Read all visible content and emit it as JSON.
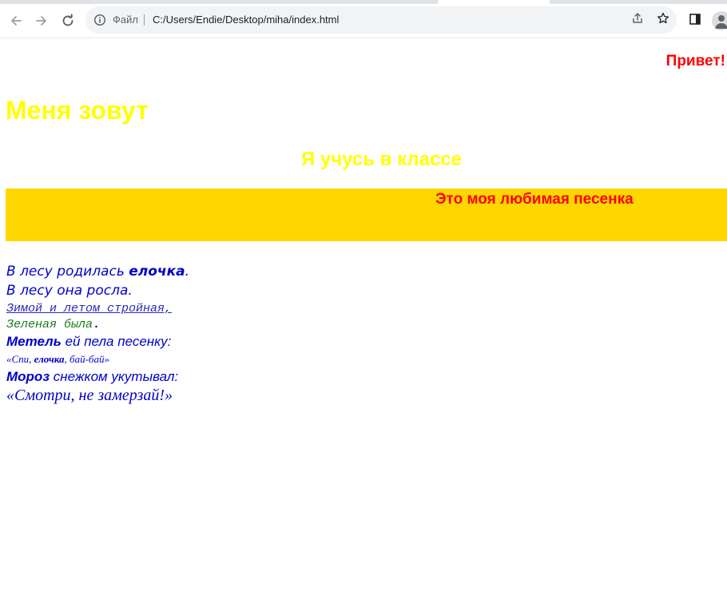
{
  "browser": {
    "file_label": "Файл",
    "url": "C:/Users/Endie/Desktop/miha/index.html",
    "icons": {
      "back": "arrow-left-icon",
      "forward": "arrow-right-icon",
      "reload": "reload-icon",
      "site_info": "info-icon",
      "share": "share-icon",
      "bookmark": "star-icon",
      "side_panel": "side-panel-icon",
      "profile": "profile-icon"
    }
  },
  "page": {
    "greeting": "Привет!",
    "name_heading": "Меня зовут",
    "class_heading": "Я учусь в классе",
    "song_title": "Это моя любимая песенка",
    "poem": {
      "line1_pre": "В лесу родилась ",
      "line1_bold": "елочка",
      "line1_post": ".",
      "line2": "В лесу она росла.",
      "line3": "Зимой и летом стройная,",
      "line4": "Зеленая была",
      "line4_dot": ".",
      "line5_bold": "Метель",
      "line5_rest": " ей пела песенку:",
      "line6_pre": "«Спи, ",
      "line6_bold": "елочка",
      "line6_post": ", бай-бай»",
      "line7_bold": "Мороз",
      "line7_rest": " снежком укутывал:",
      "line8": "«Смотри, не замерзай!»"
    },
    "colors": {
      "greeting": "#ff0000",
      "headings": "#ffff00",
      "banner_bg": "#ffd700",
      "poem_text": "#0000cc",
      "poem_green": "#1a7a1a"
    }
  }
}
